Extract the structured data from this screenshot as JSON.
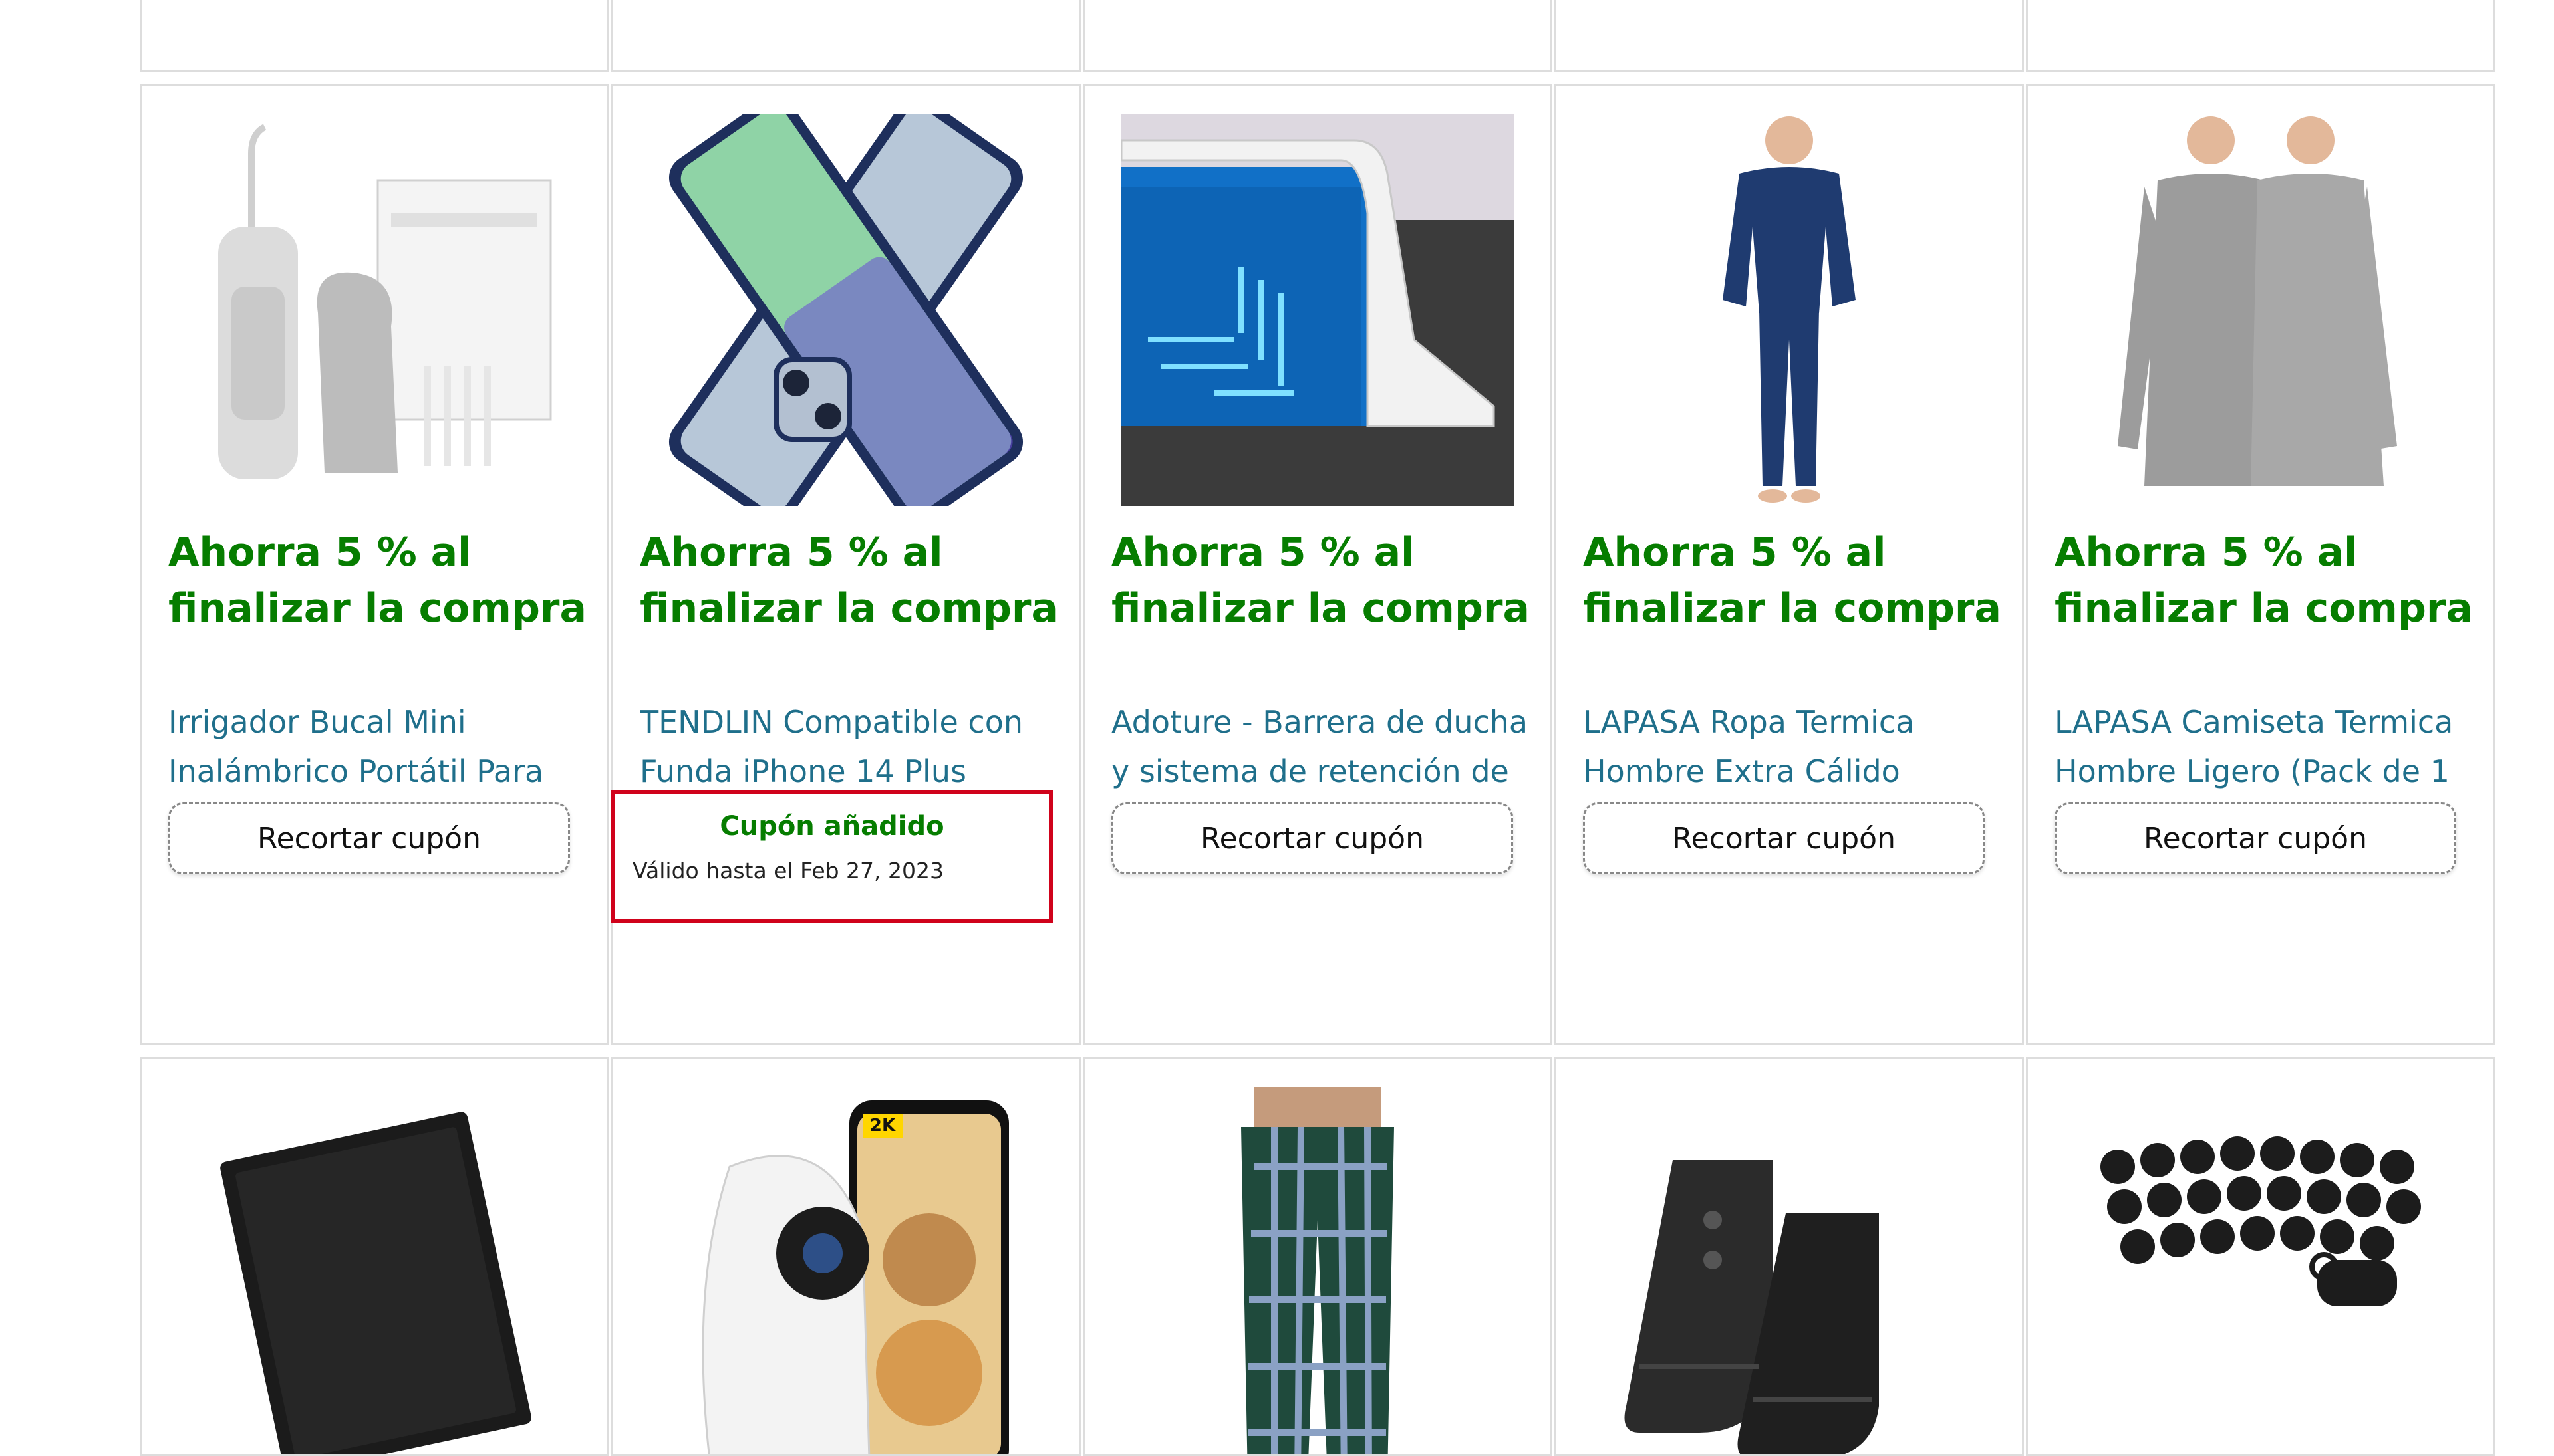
{
  "products": [
    {
      "deal": "Ahorra 5 % al finalizar la compra",
      "title": "Irrigador Bucal Mini Inalámbrico Portátil Para",
      "clip_label": "Recortar cupón",
      "image_icon": "water-flosser-image"
    },
    {
      "deal": "Ahorra 5 % al finalizar la compra",
      "title": "TENDLIN Compatible con Funda iPhone 14 Plus",
      "coupon_added": "Cupón añadido",
      "valid_until": "Válido hasta el Feb 27, 2023",
      "image_icon": "phone-case-image"
    },
    {
      "deal": "Ahorra 5 % al finalizar la compra",
      "title": "Adoture - Barrera de ducha y sistema de retención de",
      "clip_label": "Recortar cupón",
      "image_icon": "shower-barrier-image"
    },
    {
      "deal": "Ahorra 5 % al finalizar la compra",
      "title": "LAPASA Ropa Termica Hombre Extra Cálido",
      "clip_label": "Recortar cupón",
      "image_icon": "thermal-underwear-navy-image"
    },
    {
      "deal": "Ahorra 5 % al finalizar la compra",
      "title": "LAPASA Camiseta Termica Hombre Ligero (Pack de 1",
      "clip_label": "Recortar cupón",
      "image_icon": "thermal-shirt-grey-image"
    }
  ],
  "bottom_row": [
    {
      "image_icon": "wallet-image"
    },
    {
      "image_icon": "security-camera-image",
      "badge": "2K"
    },
    {
      "image_icon": "plaid-pajama-pants-image"
    },
    {
      "image_icon": "winter-boots-image"
    },
    {
      "image_icon": "dog-waste-bags-image"
    }
  ],
  "colors": {
    "deal_green": "#067d00",
    "link_teal": "#1f6f8b",
    "highlight_red": "#d0021b",
    "card_border": "#dddddd"
  }
}
